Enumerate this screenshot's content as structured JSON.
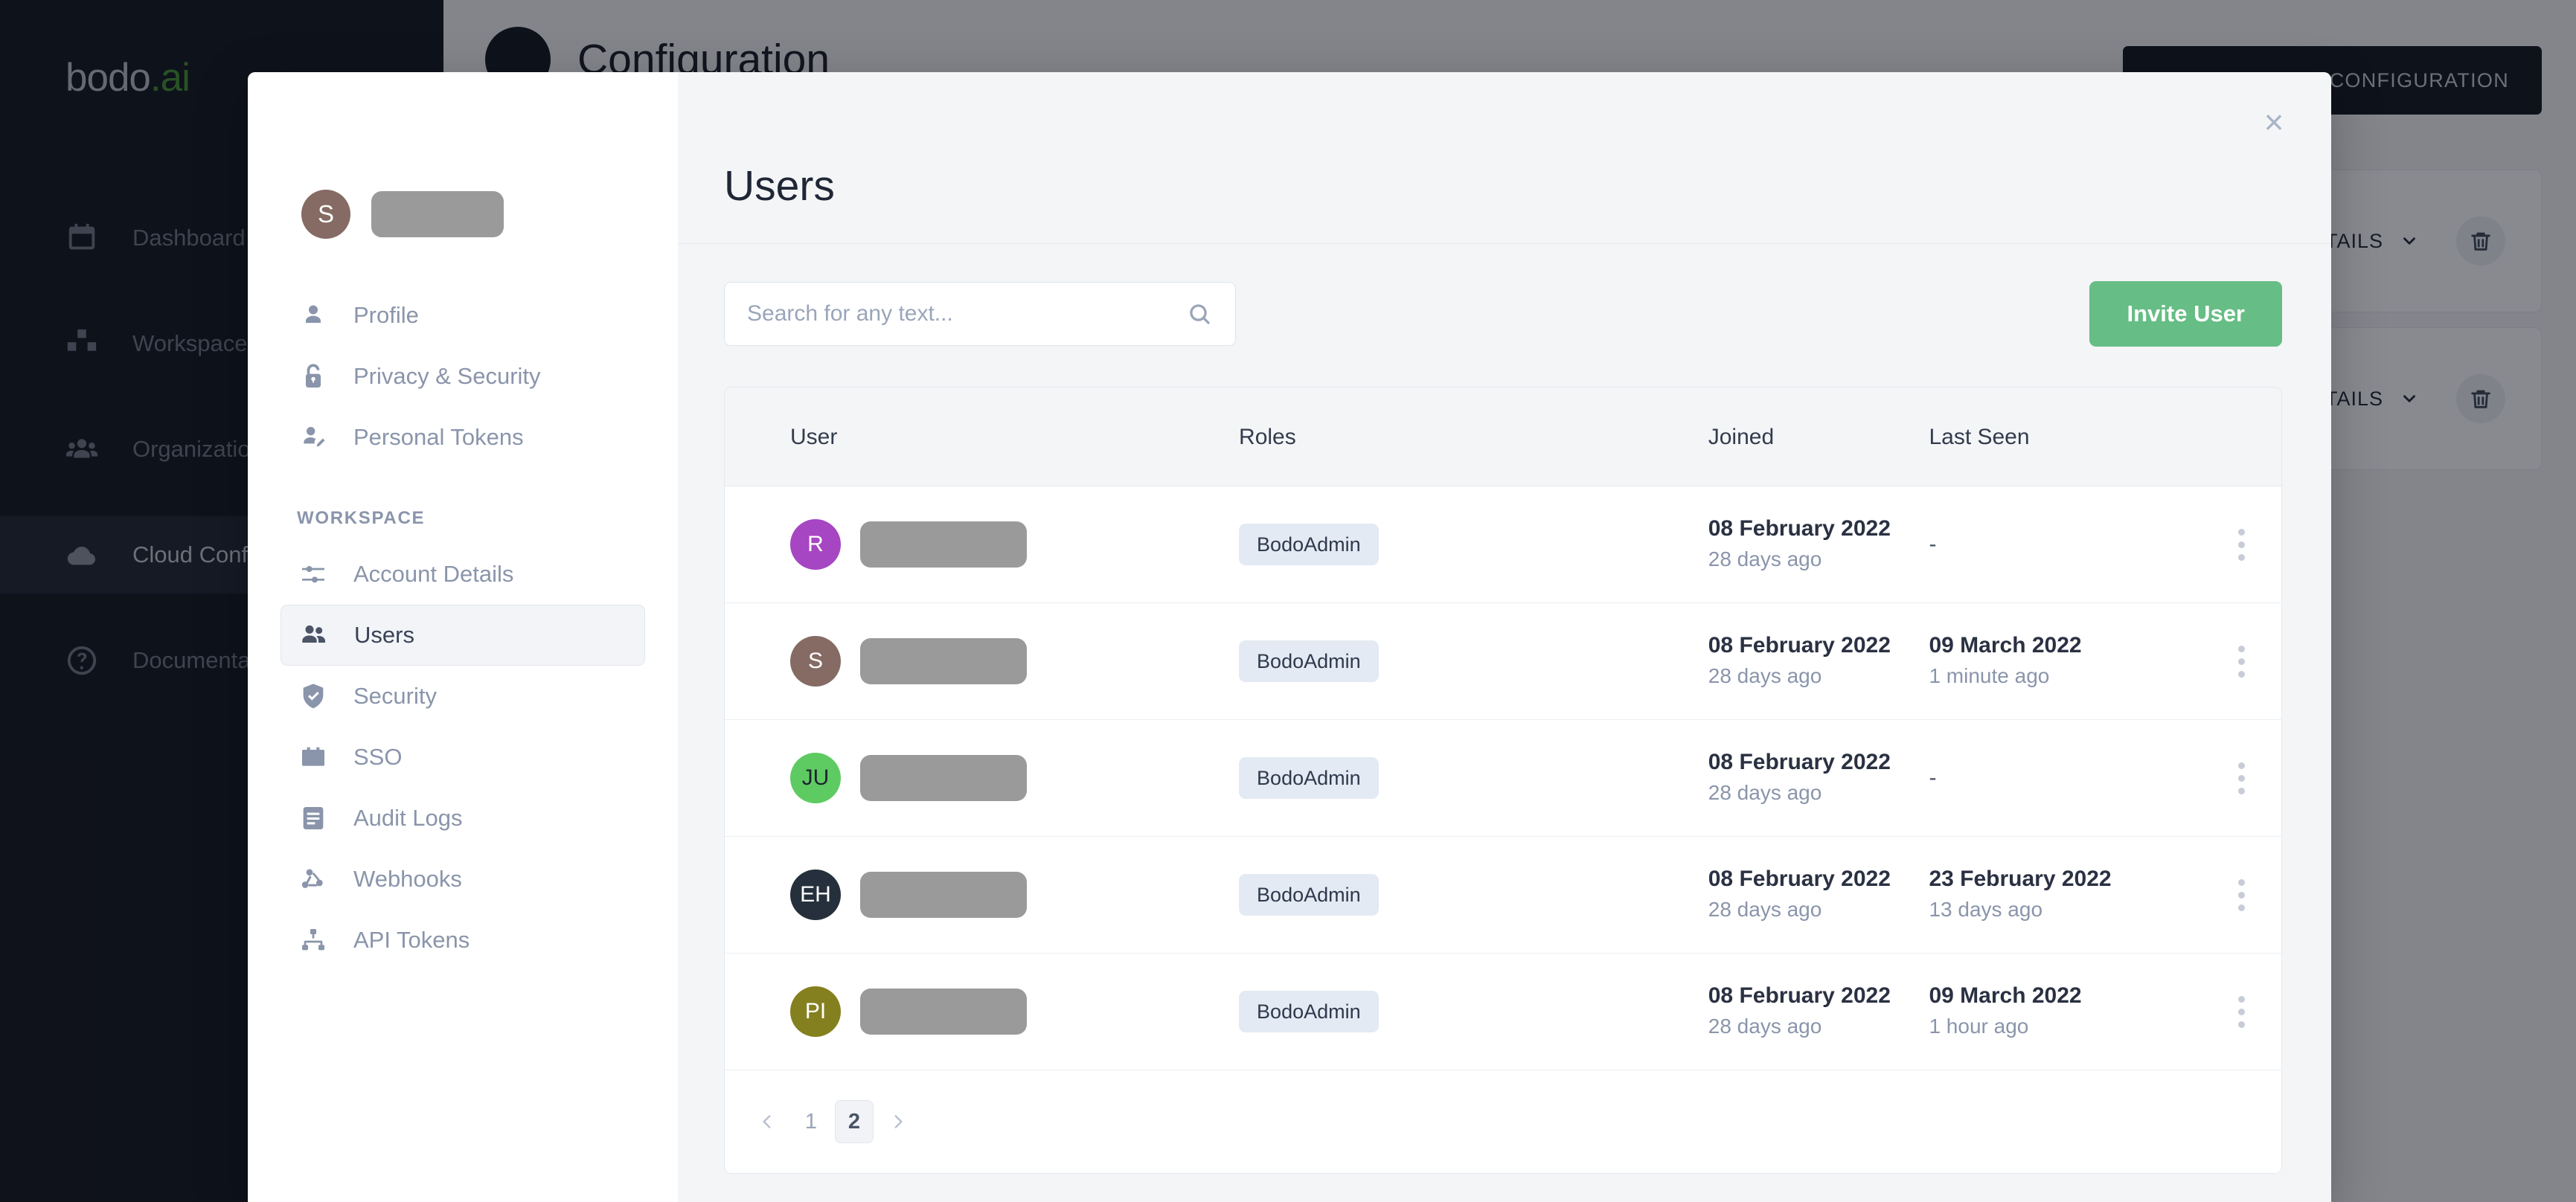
{
  "app": {
    "logo": {
      "text": "bodo",
      "suffix": ".ai"
    },
    "nav": [
      {
        "label": "Dashboard",
        "icon": "calendar-icon",
        "active": false
      },
      {
        "label": "Workspace",
        "icon": "boxes-icon",
        "active": false
      },
      {
        "label": "Organization",
        "icon": "people-icon",
        "active": false
      },
      {
        "label": "Cloud Configuration",
        "icon": "cloud-icon",
        "active": true
      },
      {
        "label": "Documentation",
        "icon": "question-circle-icon",
        "active": false
      }
    ],
    "page_title": "Configuration",
    "config_button": "CREATE CLOUD CONFIGURATION",
    "cards": [
      {
        "details_label": "DETAILS"
      },
      {
        "details_label": "DETAILS"
      }
    ]
  },
  "modal": {
    "close_label": "×",
    "account": {
      "avatar_initial": "S",
      "avatar_color": "#856b63",
      "name_redacted": true
    },
    "nav_personal": [
      {
        "label": "Profile",
        "icon": "person-icon",
        "active": false
      },
      {
        "label": "Privacy & Security",
        "icon": "unlock-icon",
        "active": false
      },
      {
        "label": "Personal Tokens",
        "icon": "person-key-icon",
        "active": false
      }
    ],
    "nav_section_label": "WORKSPACE",
    "nav_workspace": [
      {
        "label": "Account Details",
        "icon": "sliders-icon",
        "active": false
      },
      {
        "label": "Users",
        "icon": "users-icon",
        "active": true
      },
      {
        "label": "Security",
        "icon": "shield-check-icon",
        "active": false
      },
      {
        "label": "SSO",
        "icon": "id-card-icon",
        "active": false
      },
      {
        "label": "Audit Logs",
        "icon": "document-lines-icon",
        "active": false
      },
      {
        "label": "Webhooks",
        "icon": "webhook-icon",
        "active": false
      },
      {
        "label": "API Tokens",
        "icon": "sitemap-icon",
        "active": false
      }
    ],
    "title": "Users",
    "search": {
      "value": "",
      "placeholder": "Search for any text...",
      "icon": "search-icon"
    },
    "invite_button": {
      "label": "Invite User",
      "color": "#66bd85"
    },
    "table": {
      "headers": [
        "User",
        "Roles",
        "Joined",
        "Last Seen"
      ],
      "rows": [
        {
          "avatar_initial": "R",
          "avatar_color": "#a646c2",
          "avatar_text_color": "#ffffff",
          "name_redacted": true,
          "role": "BodoAdmin",
          "joined_date": "08 February 2022",
          "joined_ago": "28 days ago",
          "last_seen_date": "-",
          "last_seen_ago": ""
        },
        {
          "avatar_initial": "S",
          "avatar_color": "#856b63",
          "avatar_text_color": "#ffffff",
          "name_redacted": true,
          "role": "BodoAdmin",
          "joined_date": "08 February 2022",
          "joined_ago": "28 days ago",
          "last_seen_date": "09 March 2022",
          "last_seen_ago": "1 minute ago"
        },
        {
          "avatar_initial": "JU",
          "avatar_color": "#5ecb62",
          "avatar_text_color": "#1d2330",
          "name_redacted": true,
          "role": "BodoAdmin",
          "joined_date": "08 February 2022",
          "joined_ago": "28 days ago",
          "last_seen_date": "-",
          "last_seen_ago": ""
        },
        {
          "avatar_initial": "EH",
          "avatar_color": "#25303c",
          "avatar_text_color": "#ffffff",
          "name_redacted": true,
          "role": "BodoAdmin",
          "joined_date": "08 February 2022",
          "joined_ago": "28 days ago",
          "last_seen_date": "23 February 2022",
          "last_seen_ago": "13 days ago"
        },
        {
          "avatar_initial": "PI",
          "avatar_color": "#84801f",
          "avatar_text_color": "#ffffff",
          "name_redacted": true,
          "role": "BodoAdmin",
          "joined_date": "08 February 2022",
          "joined_ago": "28 days ago",
          "last_seen_date": "09 March 2022",
          "last_seen_ago": "1 hour ago"
        }
      ],
      "row_menu_icon": "kebab-menu-icon"
    },
    "pagination": {
      "prev_icon": "chevron-left-icon",
      "next_icon": "chevron-right-icon",
      "pages": [
        "1",
        "2"
      ],
      "current": "2"
    }
  }
}
